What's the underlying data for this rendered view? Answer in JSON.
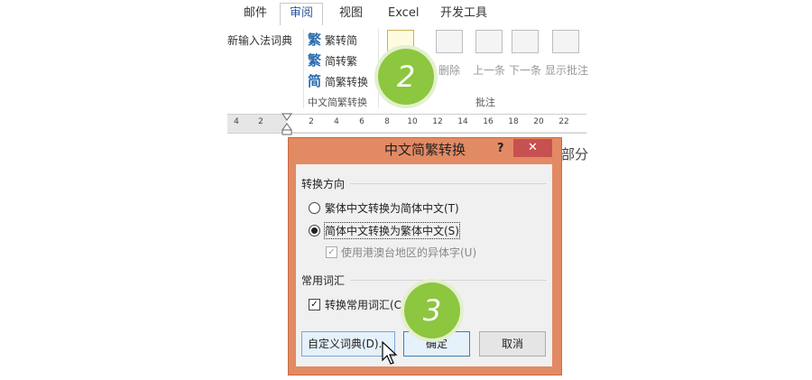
{
  "ribbon": {
    "tabs": [
      "邮件",
      "审阅",
      "视图",
      "Excel",
      "开发工具"
    ],
    "active_tab": "审阅",
    "new_ime_dictionary": "新输入法词典",
    "trad_to_simp": "繁转简",
    "simp_to_trad": "简转繁",
    "simp_trad_convert": "简繁转换",
    "chinese_conversion_group": "中文简繁转换",
    "comments_group": "批注",
    "delete_label": "删除",
    "previous_label": "上一条",
    "next_label": "下一条",
    "show_comments_label": "显示批注"
  },
  "ruler": {
    "ticks": [
      "4",
      "2",
      "2",
      "4",
      "6",
      "8",
      "10",
      "12",
      "14",
      "16",
      "18",
      "20",
      "22"
    ]
  },
  "step_badges": {
    "step2": "2",
    "step3": "3"
  },
  "document": {
    "line1": "部分"
  },
  "dialog": {
    "title": "中文简繁转换",
    "help": "?",
    "close": "✕",
    "direction_section": "转换方向",
    "option_trad_to_simp": "繁体中文转换为简体中文(T)",
    "option_simp_to_trad": "简体中文转换为繁体中文(S)",
    "option_hk_variants": "使用港澳台地区的异体字(U)",
    "vocab_section": "常用词汇",
    "option_convert_common": "转换常用词汇(C)",
    "custom_dict_button": "自定义词典(D)...",
    "ok_button": "确定",
    "cancel_button": "取消"
  },
  "colors": {
    "dialog_frame": "#e28a63",
    "close_button": "#c75050",
    "badge": "#8dc63f",
    "active_tab_text": "#2b579a"
  }
}
